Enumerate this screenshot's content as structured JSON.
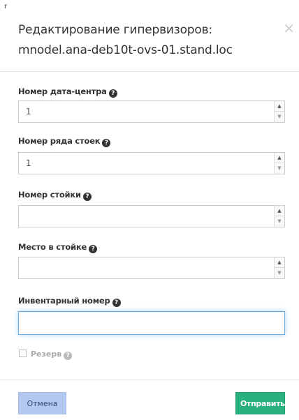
{
  "modal": {
    "corner_mark": "r",
    "title": "Редактирование гипервизоров: mnodel.ana-deb10t-ovs-01.stand.loc",
    "close_glyph": "×"
  },
  "fields": {
    "datacenter": {
      "label": "Номер дата-центра",
      "value": "1"
    },
    "rack_row": {
      "label": "Номер ряда стоек",
      "value": "1"
    },
    "rack": {
      "label": "Номер стойки",
      "value": ""
    },
    "rack_place": {
      "label": "Место в стойке",
      "value": ""
    },
    "inventory": {
      "label": "Инвентарный номер",
      "value": ""
    }
  },
  "reserve": {
    "label": "Резерв",
    "checked": false
  },
  "footer": {
    "cancel_label": "Отмена",
    "submit_label": "Отправить"
  },
  "icons": {
    "help": "question-circle-icon",
    "close": "close-icon",
    "spin_up": "▲",
    "spin_down": "▼"
  },
  "colors": {
    "cancel_bg": "#b3c8ef",
    "submit_bg": "#2bb07f",
    "focus_border": "#66afe9"
  }
}
